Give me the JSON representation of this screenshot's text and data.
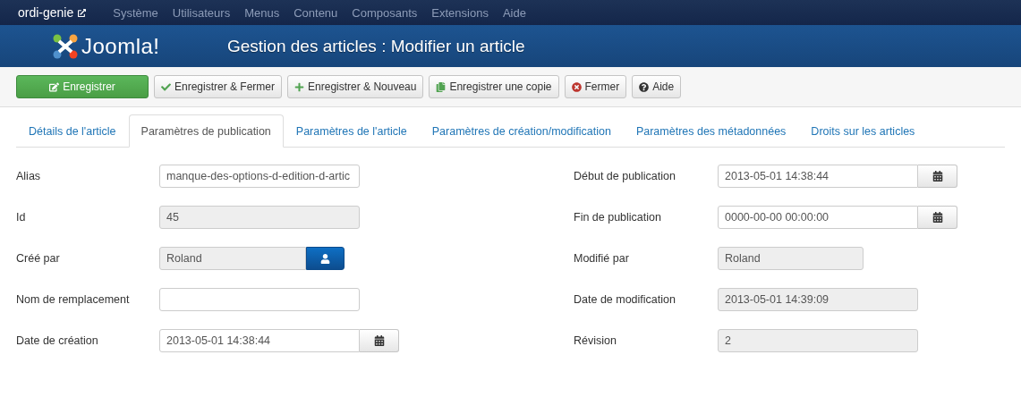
{
  "topnav": {
    "site": "ordi-genie",
    "menu": [
      "Système",
      "Utilisateurs",
      "Menus",
      "Contenu",
      "Composants",
      "Extensions",
      "Aide"
    ]
  },
  "header": {
    "logo": "Joomla!",
    "title": "Gestion des articles : Modifier un article"
  },
  "toolbar": [
    {
      "kind": "save",
      "label": "Enregistrer"
    },
    {
      "kind": "check",
      "label": "Enregistrer & Fermer"
    },
    {
      "kind": "plus",
      "label": "Enregistrer & Nouveau"
    },
    {
      "kind": "copy",
      "label": "Enregistrer une copie"
    },
    {
      "kind": "close",
      "label": "Fermer"
    },
    {
      "kind": "help",
      "label": "Aide"
    }
  ],
  "tabs": [
    {
      "label": "Détails de l'article",
      "selected": false
    },
    {
      "label": "Paramètres de publication",
      "selected": true
    },
    {
      "label": "Paramètres de l'article",
      "selected": false
    },
    {
      "label": "Paramètres de création/modification",
      "selected": false
    },
    {
      "label": "Paramètres des métadonnées",
      "selected": false
    },
    {
      "label": "Droits sur les articles",
      "selected": false
    }
  ],
  "left_fields": [
    {
      "label": "Alias",
      "kind": "text",
      "value": "manque-des-options-d-edition-d-artic"
    },
    {
      "label": "Id",
      "kind": "readonly",
      "value": "45"
    },
    {
      "label": "Créé par",
      "kind": "user",
      "value": "Roland"
    },
    {
      "label": "Nom de remplacement",
      "kind": "text"
    },
    {
      "label": "Date de création",
      "kind": "date",
      "value": "2013-05-01 14:38:44"
    }
  ],
  "right_fields": [
    {
      "label": "Début de publication",
      "kind": "date",
      "value": "2013-05-01 14:38:44"
    },
    {
      "label": "Fin de publication",
      "kind": "date",
      "value": "0000-00-00 00:00:00"
    },
    {
      "label": "Modifié par",
      "kind": "readonly-narrow",
      "value": "Roland"
    },
    {
      "label": "Date de modification",
      "kind": "readonly",
      "value": "2013-05-01 14:39:09"
    },
    {
      "label": "Révision",
      "kind": "readonly",
      "value": "2"
    }
  ]
}
